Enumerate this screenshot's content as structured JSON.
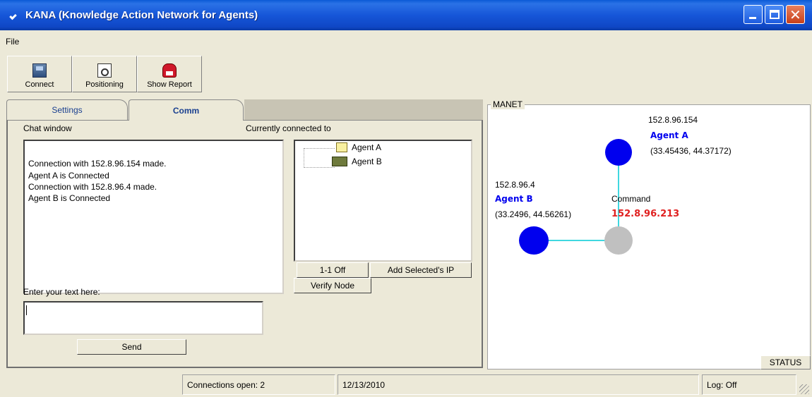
{
  "window": {
    "title": "KANA (Knowledge Action Network for Agents)"
  },
  "menu": {
    "file": "File"
  },
  "toolbar": {
    "connect": "Connect",
    "positioning": "Positioning",
    "show_report": "Show Report"
  },
  "tabs": {
    "settings": "Settings",
    "comm": "Comm"
  },
  "comm": {
    "chat_label": "Chat window",
    "chat_lines": [
      "Connection with 152.8.96.154 made.",
      "Agent A is Connected",
      "Connection with 152.8.96.4 made.",
      "Agent B is Connected"
    ],
    "connected_label": "Currently connected to",
    "agents": [
      "Agent A",
      "Agent B"
    ],
    "btn_one_to_one": "1-1 Off",
    "btn_add_ip": "Add  Selected's IP",
    "btn_verify": "Verify Node",
    "input_label": "Enter your text here:",
    "input_value": "",
    "send": "Send"
  },
  "manet": {
    "title": "MANET",
    "agent_a": {
      "ip": "152.8.96.154",
      "name": "Agent A",
      "coords": "(33.45436, 44.37172)",
      "color": "#0000ee"
    },
    "agent_b": {
      "ip": "152.8.96.4",
      "name": "Agent B",
      "coords": "(33.2496, 44.56261)",
      "color": "#0000ee"
    },
    "command": {
      "label": "Command",
      "ip": "152.8.96.213",
      "ip_color": "#e02020",
      "color": "#c0c0c0"
    },
    "link_color": "#40d8e0",
    "status_button": "STATUS"
  },
  "statusbar": {
    "connections": "Connections open: 2",
    "date": "12/13/2010",
    "log": "Log: Off"
  }
}
